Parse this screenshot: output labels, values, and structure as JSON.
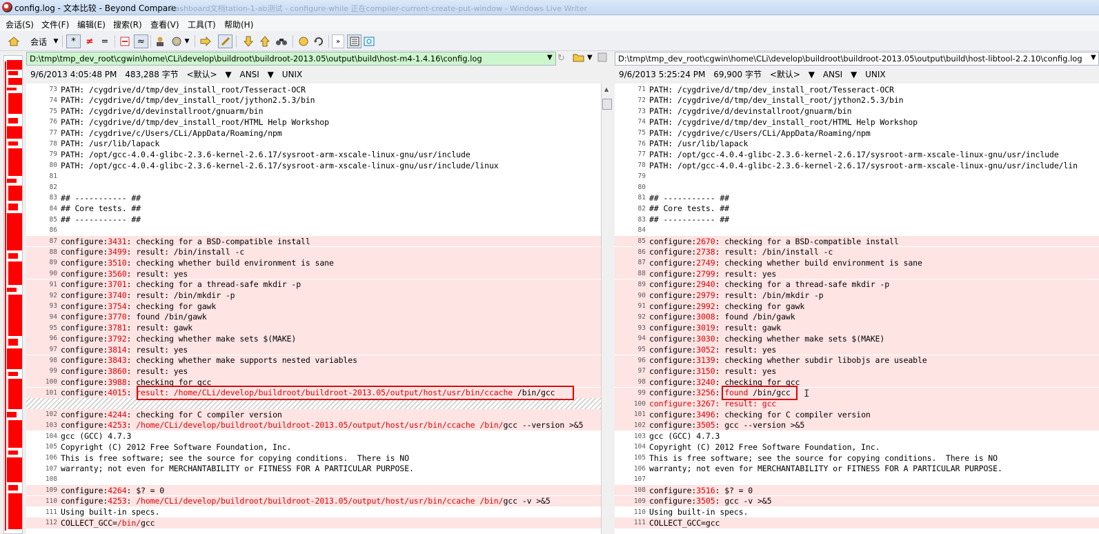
{
  "window": {
    "title": "config.log - 文本比较 - Beyond Compare",
    "ghost_text": "Dashboard文档tation-1-ab测试 - configure-while 正在compiler-current-create-put-window - Windows Live Writer"
  },
  "menu": [
    "会话(S)",
    "文件(F)",
    "编辑(E)",
    "搜索(R)",
    "查看(V)",
    "工具(T)",
    "帮助(H)"
  ],
  "toolbar": {
    "home_label": "会话",
    "buttons": [
      "*",
      "≠",
      "="
    ]
  },
  "left": {
    "path": "D:\\tmp\\tmp_dev_root\\cgwin\\home\\CLi\\develop\\buildroot\\buildroot-2013.05\\output\\build\\host-m4-1.4.16\\config.log",
    "info": [
      "9/6/2013 4:05:48 PM",
      "483,288 字节",
      "<默认>",
      "ANSI",
      "UNIX"
    ]
  },
  "right": {
    "path": "D:\\tmp\\tmp_dev_root\\cgwin\\home\\CLi\\develop\\buildroot\\buildroot-2013.05\\output\\build\\host-libtool-2.2.10\\config.log",
    "info": [
      "9/6/2013 5:25:24 PM",
      "69,900 字节",
      "<默认>",
      "ANSI",
      "UNIX"
    ]
  },
  "left_lines": [
    {
      "n": "73",
      "t": "PATH: /cygdrive/d/tmp/dev_install_root/Tesseract-OCR"
    },
    {
      "n": "74",
      "t": "PATH: /cygdrive/d/tmp/dev_install_root/jython2.5.3/bin"
    },
    {
      "n": "75",
      "t": "PATH: /cygdrive/d/devinstallroot/gnuarm/bin"
    },
    {
      "n": "76",
      "t": "PATH: /cygdrive/d/tmp/dev_install_root/HTML Help Workshop"
    },
    {
      "n": "77",
      "t": "PATH: /cygdrive/c/Users/CLi/AppData/Roaming/npm"
    },
    {
      "n": "78",
      "t": "PATH: /usr/lib/lapack"
    },
    {
      "n": "79",
      "t": "PATH: /opt/gcc-4.0.4-glibc-2.3.6-kernel-2.6.17/sysroot-arm-xscale-linux-gnu/usr/include"
    },
    {
      "n": "80",
      "t": "PATH: /opt/gcc-4.0.4-glibc-2.3.6-kernel-2.6.17/sysroot-arm-xscale-linux-gnu/usr/include/linux"
    },
    {
      "n": "81",
      "t": ""
    },
    {
      "n": "82",
      "t": ""
    },
    {
      "n": "83",
      "t": "## ----------- ##"
    },
    {
      "n": "84",
      "t": "## Core tests. ##"
    },
    {
      "n": "85",
      "t": "## ----------- ##"
    },
    {
      "n": "86",
      "t": ""
    },
    {
      "n": "87",
      "d": 1,
      "p": "configure:",
      "r": "3431",
      "s": ": checking for a BSD-compatible install"
    },
    {
      "n": "88",
      "d": 1,
      "p": "configure:",
      "r": "3499",
      "s": ": result: /bin/install -c"
    },
    {
      "n": "89",
      "d": 1,
      "p": "configure:",
      "r": "3510",
      "s": ": checking whether build environment is sane"
    },
    {
      "n": "90",
      "d": 1,
      "p": "configure:",
      "r": "3560",
      "s": ": result: yes"
    },
    {
      "n": "91",
      "d": 1,
      "p": "configure:",
      "r": "3701",
      "s": ": checking for a thread-safe mkdir -p"
    },
    {
      "n": "92",
      "d": 1,
      "p": "configure:",
      "r": "3740",
      "s": ": result: /bin/mkdir -p"
    },
    {
      "n": "93",
      "d": 1,
      "p": "configure:",
      "r": "3754",
      "s": ": checking for gawk"
    },
    {
      "n": "94",
      "d": 1,
      "p": "configure:",
      "r": "3770",
      "s": ": found /bin/gawk"
    },
    {
      "n": "95",
      "d": 1,
      "p": "configure:",
      "r": "3781",
      "s": ": result: gawk"
    },
    {
      "n": "96",
      "d": 1,
      "p": "configure:",
      "r": "3792",
      "s": ": checking whether make sets $(MAKE)"
    },
    {
      "n": "97",
      "d": 1,
      "p": "configure:",
      "r": "3814",
      "s": ": result: yes"
    },
    {
      "n": "98",
      "d": 1,
      "p": "configure:",
      "r": "3843",
      "s": ": checking whether make supports nested variables"
    },
    {
      "n": "99",
      "d": 1,
      "p": "configure:",
      "r": "3860",
      "s": ": result: yes"
    },
    {
      "n": "100",
      "d": 1,
      "p": "configure:",
      "r": "3988",
      "s": ": checking for gcc"
    },
    {
      "n": "101",
      "d": 1,
      "p": "configure:",
      "r": "4015",
      "s": ": ",
      "r2": "result: /home/CLi/develop/buildroot/buildroot-2013.05/output/host/usr/bin/ccache",
      "s2": " /bin/gcc"
    },
    {
      "n": "",
      "h": 1
    },
    {
      "n": "102",
      "d": 1,
      "p": "configure:",
      "r": "4244",
      "s": ": checking for C compiler version"
    },
    {
      "n": "103",
      "d": 1,
      "p": "configure:",
      "r": "4253",
      "s": ": ",
      "r2": "/home/CLi/develop/buildroot/buildroot-2013.05/output/host/usr/bin/ccache /bin/",
      "s2": "gcc --version >&5"
    },
    {
      "n": "104",
      "t": "gcc (GCC) 4.7.3"
    },
    {
      "n": "105",
      "t": "Copyright (C) 2012 Free Software Foundation, Inc."
    },
    {
      "n": "106",
      "t": "This is free software; see the source for copying conditions.  There is NO"
    },
    {
      "n": "107",
      "t": "warranty; not even for MERCHANTABILITY or FITNESS FOR A PARTICULAR PURPOSE."
    },
    {
      "n": "108",
      "t": ""
    },
    {
      "n": "109",
      "d": 1,
      "p": "configure:",
      "r": "4264",
      "s": ": $? = 0"
    },
    {
      "n": "110",
      "d": 1,
      "p": "configure:",
      "r": "4253",
      "s": ": ",
      "r2": "/home/CLi/develop/buildroot/buildroot-2013.05/output/host/usr/bin/ccache /bin/",
      "s2": "gcc -v >&5"
    },
    {
      "n": "111",
      "t": "Using built-in specs."
    },
    {
      "n": "112",
      "d": 1,
      "p": "COLLECT_GCC=",
      "r": "/bin/",
      "s": "gcc"
    }
  ],
  "right_lines": [
    {
      "n": "71",
      "t": "PATH: /cygdrive/d/tmp/dev_install_root/Tesseract-OCR"
    },
    {
      "n": "72",
      "t": "PATH: /cygdrive/d/tmp/dev_install_root/jython2.5.3/bin"
    },
    {
      "n": "73",
      "t": "PATH: /cygdrive/d/devinstallroot/gnuarm/bin"
    },
    {
      "n": "74",
      "t": "PATH: /cygdrive/d/tmp/dev_install_root/HTML Help Workshop"
    },
    {
      "n": "75",
      "t": "PATH: /cygdrive/c/Users/CLi/AppData/Roaming/npm"
    },
    {
      "n": "76",
      "t": "PATH: /usr/lib/lapack"
    },
    {
      "n": "77",
      "t": "PATH: /opt/gcc-4.0.4-glibc-2.3.6-kernel-2.6.17/sysroot-arm-xscale-linux-gnu/usr/include"
    },
    {
      "n": "78",
      "t": "PATH: /opt/gcc-4.0.4-glibc-2.3.6-kernel-2.6.17/sysroot-arm-xscale-linux-gnu/usr/include/lin"
    },
    {
      "n": "79",
      "t": ""
    },
    {
      "n": "80",
      "t": ""
    },
    {
      "n": "81",
      "t": "## ----------- ##"
    },
    {
      "n": "82",
      "t": "## Core tests. ##"
    },
    {
      "n": "83",
      "t": "## ----------- ##"
    },
    {
      "n": "84",
      "t": ""
    },
    {
      "n": "85",
      "d": 1,
      "p": "configure:",
      "r": "2670",
      "s": ": checking for a BSD-compatible install"
    },
    {
      "n": "86",
      "d": 1,
      "p": "configure:",
      "r": "2738",
      "s": ": result: /bin/install -c"
    },
    {
      "n": "87",
      "d": 1,
      "p": "configure:",
      "r": "2749",
      "s": ": checking whether build environment is sane"
    },
    {
      "n": "88",
      "d": 1,
      "p": "configure:",
      "r": "2799",
      "s": ": result: yes"
    },
    {
      "n": "89",
      "d": 1,
      "p": "configure:",
      "r": "2940",
      "s": ": checking for a thread-safe mkdir -p"
    },
    {
      "n": "90",
      "d": 1,
      "p": "configure:",
      "r": "2979",
      "s": ": result: /bin/mkdir -p"
    },
    {
      "n": "91",
      "d": 1,
      "p": "configure:",
      "r": "2992",
      "s": ": checking for gawk"
    },
    {
      "n": "92",
      "d": 1,
      "p": "configure:",
      "r": "3008",
      "s": ": found /bin/gawk"
    },
    {
      "n": "93",
      "d": 1,
      "p": "configure:",
      "r": "3019",
      "s": ": result: gawk"
    },
    {
      "n": "94",
      "d": 1,
      "p": "configure:",
      "r": "3030",
      "s": ": checking whether make sets $(MAKE)"
    },
    {
      "n": "95",
      "d": 1,
      "p": "configure:",
      "r": "3052",
      "s": ": result: yes"
    },
    {
      "n": "96",
      "d": 1,
      "p": "configure:",
      "r": "3139",
      "s": ": checking whether subdir libobjs are useable"
    },
    {
      "n": "97",
      "d": 1,
      "p": "configure:",
      "r": "3150",
      "s": ": result: yes"
    },
    {
      "n": "98",
      "d": 1,
      "p": "configure:",
      "r": "3240",
      "s": ": checking for gcc"
    },
    {
      "n": "99",
      "d": 1,
      "p": "configure:",
      "r": "3256",
      "s": ": ",
      "r2": "found",
      "s2": " /bin/gcc"
    },
    {
      "n": "100",
      "d": 1,
      "p": "configure:",
      "r": "3267",
      "s": ": result: gcc",
      "allred": 1
    },
    {
      "n": "101",
      "d": 1,
      "p": "configure:",
      "r": "3496",
      "s": ": checking for C compiler version"
    },
    {
      "n": "102",
      "d": 1,
      "p": "configure:",
      "r": "3505",
      "s": ": gcc --version >&5"
    },
    {
      "n": "103",
      "t": "gcc (GCC) 4.7.3"
    },
    {
      "n": "104",
      "t": "Copyright (C) 2012 Free Software Foundation, Inc."
    },
    {
      "n": "105",
      "t": "This is free software; see the source for copying conditions.  There is NO"
    },
    {
      "n": "106",
      "t": "warranty; not even for MERCHANTABILITY or FITNESS FOR A PARTICULAR PURPOSE."
    },
    {
      "n": "107",
      "t": ""
    },
    {
      "n": "108",
      "d": 1,
      "p": "configure:",
      "r": "3516",
      "s": ": $? = 0"
    },
    {
      "n": "109",
      "d": 1,
      "p": "configure:",
      "r": "3505",
      "s": ": gcc -v >&5"
    },
    {
      "n": "110",
      "t": "Using built-in specs."
    },
    {
      "n": "111",
      "d": 1,
      "p": "COLLECT_GCC=gcc",
      "r": "",
      "s": ""
    }
  ],
  "colors": {
    "diff_bg": "#ffe4e4",
    "diff_text": "#e00000",
    "left_path_bg": "#ccf7cc"
  }
}
